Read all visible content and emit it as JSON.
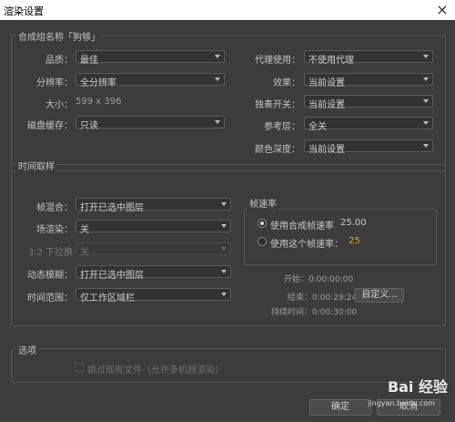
{
  "window": {
    "title": "渲染设置",
    "close": "×"
  },
  "comp_group": {
    "title": "合成组名称「狗够」",
    "quality": {
      "label": "品质：",
      "value": "最佳"
    },
    "resolution": {
      "label": "分辨率：",
      "value": "全分辨率"
    },
    "size": {
      "label": "大小：",
      "value": "599 x 396"
    },
    "disk_cache": {
      "label": "磁盘缓存：",
      "value": "只读"
    },
    "proxy": {
      "label": "代理使用：",
      "value": "不使用代理"
    },
    "effects": {
      "label": "效果：",
      "value": "当前设置"
    },
    "solo": {
      "label": "独奏开关：",
      "value": "当前设置"
    },
    "guide": {
      "label": "参考层：",
      "value": "全关"
    },
    "depth": {
      "label": "颜色深度：",
      "value": "当前设置"
    }
  },
  "time_group": {
    "title": "时间取样",
    "frame_blend": {
      "label": "帧混合：",
      "value": "打开已选中图层"
    },
    "field_render": {
      "label": "场渲染：",
      "value": "关"
    },
    "pulldown": {
      "label": "3:2 下拉换",
      "value": "关"
    },
    "motion_blur": {
      "label": "动态模糊：",
      "value": "打开已选中图层"
    },
    "time_span": {
      "label": "时间范围：",
      "value": "仅工作区域栏"
    },
    "frame_rate": {
      "title": "帧速率",
      "use_comp": "使用合成帧速率",
      "comp_value": "25.00",
      "use_this": "使用这个帧速率：",
      "this_value": "25"
    },
    "start": "开始：0:00:00:00",
    "end": "结束：0:00:29:24",
    "duration": "持续时间：0:00:30:00",
    "custom_btn": "自定义..."
  },
  "options_group": {
    "title": "选项",
    "skip_existing": "跳过现有文件（允许多机器渲染）"
  },
  "footer": {
    "ok": "确定",
    "cancel": "取消"
  },
  "watermark": {
    "main": "Bai 经验",
    "sub": "jingyan.baidu.com"
  }
}
